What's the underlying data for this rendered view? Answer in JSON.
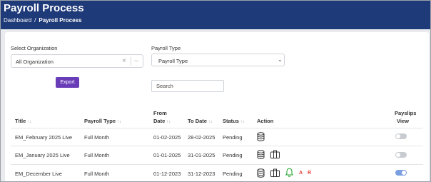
{
  "header": {
    "title": "Payroll Process",
    "breadcrumb": {
      "home": "Dashboard",
      "separator": "/",
      "current": "Payroll Process"
    }
  },
  "filters": {
    "organization": {
      "label": "Select Organization",
      "value": "All Organization",
      "clear_icon": "×",
      "chevron_icon": "⌵"
    },
    "payroll_type": {
      "label": "Payroll Type",
      "value": "Payroll Type",
      "chevron_icon": "⌄"
    },
    "export_label": "Export",
    "search_placeholder": "Search"
  },
  "table": {
    "columns": {
      "title": "Title",
      "payroll_type": "Payroll Type",
      "from_date_1": "From",
      "from_date_2": "Date",
      "to_date": "To Date",
      "status": "Status",
      "action": "Action",
      "payslips_1": "Payslips",
      "payslips_2": "View",
      "sort_glyph": "↑↓"
    },
    "rows": [
      {
        "title": "EM_February 2025 Live",
        "payroll_type": "Full Month",
        "from": "01-02-2025",
        "to": "28-02-2025",
        "status": "Pending",
        "actions": [
          "database-icon"
        ],
        "payslips_view": false
      },
      {
        "title": "EM_January 2025 Live",
        "payroll_type": "Full Month",
        "from": "01-01-2025",
        "to": "31-01-2025",
        "status": "Pending",
        "actions": [
          "database-icon",
          "briefcase-icon"
        ],
        "payslips_view": false
      },
      {
        "title": "EM_December Live",
        "payroll_type": "Full Month",
        "from": "01-12-2023",
        "to": "31-12-2023",
        "status": "Pending",
        "actions": [
          "database-icon",
          "briefcase-icon",
          "bell-icon",
          "A",
          "R"
        ],
        "payslips_view": true
      }
    ]
  },
  "colors": {
    "header_bg": "#1f3a78",
    "export_button": "#6a3db8",
    "bell": "#2eaa3a",
    "red_letters": "#e53935",
    "toggle_on": "#7a9fe0"
  }
}
